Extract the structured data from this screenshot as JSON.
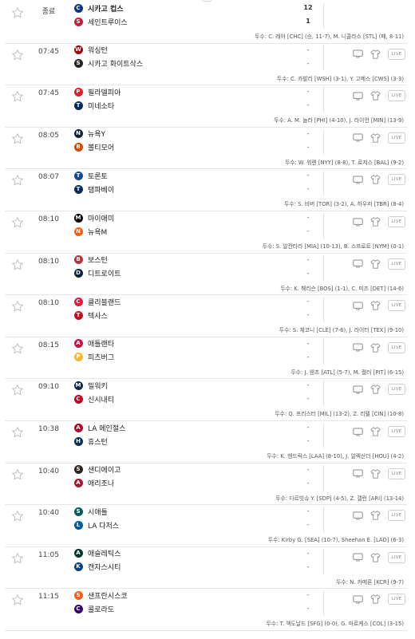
{
  "games": [
    {
      "status": "종료",
      "away": {
        "name": "시카고 컵스",
        "bold": true,
        "color": "#0e3386",
        "abbr": "C"
      },
      "home": {
        "name": "세인트루이스",
        "bold": false,
        "color": "#c41e3a",
        "abbr": "S"
      },
      "score_away": "12",
      "score_home": "1",
      "final": true,
      "pitchers": "두수: C. 레아 [CHC] (승, 11-7), M. 니콜라스 [STL] (패, 8-11)"
    },
    {
      "status": "07:45",
      "away": {
        "name": "워싱턴",
        "bold": false,
        "color": "#ab0003",
        "abbr": "W"
      },
      "home": {
        "name": "시카고 화이트삭스",
        "bold": false,
        "color": "#27251f",
        "abbr": "S"
      },
      "score_away": "-",
      "score_home": "-",
      "final": false,
      "pitchers": "두수: C. 카발리 [WSH] (3-1), Y. 고메스 [CWS] (3-3)"
    },
    {
      "status": "07:45",
      "away": {
        "name": "필라델피아",
        "bold": false,
        "color": "#e81828",
        "abbr": "P"
      },
      "home": {
        "name": "미네소타",
        "bold": false,
        "color": "#002b5c",
        "abbr": "T"
      },
      "score_away": "-",
      "score_home": "-",
      "final": false,
      "pitchers": "두수: A. M. 놀라 [PHI] (4-10), J. 라이언 [MIN] (13-9)"
    },
    {
      "status": "08:05",
      "away": {
        "name": "뉴욕Y",
        "bold": false,
        "color": "#0c2340",
        "abbr": "NY"
      },
      "home": {
        "name": "볼티모어",
        "bold": false,
        "color": "#df4601",
        "abbr": "B"
      },
      "score_away": "-",
      "score_home": "-",
      "final": false,
      "pitchers": "두수: W. 워렌 [NYY] (8-8), T. 로저스 [BAL] (9-2)"
    },
    {
      "status": "08:07",
      "away": {
        "name": "토론토",
        "bold": false,
        "color": "#134a8e",
        "abbr": "T"
      },
      "home": {
        "name": "탬파베이",
        "bold": false,
        "color": "#092c5c",
        "abbr": "TB"
      },
      "score_away": "-",
      "score_home": "-",
      "final": false,
      "pitchers": "두수: S. 비버 [TOR] (3-2), A. 하우저 [TBR] (8-4)"
    },
    {
      "status": "08:10",
      "away": {
        "name": "마이애미",
        "bold": false,
        "color": "#000000",
        "abbr": "M"
      },
      "home": {
        "name": "뉴욕M",
        "bold": false,
        "color": "#ff5910",
        "abbr": "NY"
      },
      "score_away": "-",
      "score_home": "-",
      "final": false,
      "pitchers": "두수: S. 알칸타라 [MIA] (10-13), B. 스프로트 [NYM] (0-1)"
    },
    {
      "status": "08:10",
      "away": {
        "name": "보스턴",
        "bold": false,
        "color": "#bd3039",
        "abbr": "B"
      },
      "home": {
        "name": "디트로이트",
        "bold": false,
        "color": "#0c2340",
        "abbr": "D"
      },
      "score_away": "-",
      "score_home": "-",
      "final": false,
      "pitchers": "두수: K. 해리슨 [BOS] (1-1), C. 미즈 [DET] (14-6)"
    },
    {
      "status": "08:10",
      "away": {
        "name": "클리블랜드",
        "bold": false,
        "color": "#e31937",
        "abbr": "C"
      },
      "home": {
        "name": "텍사스",
        "bold": false,
        "color": "#c0111f",
        "abbr": "T"
      },
      "score_away": "-",
      "score_home": "-",
      "final": false,
      "pitchers": "두수: S. 체코니 [CLE] (7-6), J. 라이터 [TEX] (9-10)"
    },
    {
      "status": "08:15",
      "away": {
        "name": "애틀랜타",
        "bold": false,
        "color": "#ce1141",
        "abbr": "A"
      },
      "home": {
        "name": "피츠버그",
        "bold": false,
        "color": "#fdb827",
        "abbr": "P"
      },
      "score_away": "-",
      "score_home": "-",
      "final": false,
      "pitchers": "두수: J. 웬츠 [ATL] (5-7), M. 켈러 [PIT] (6-15)"
    },
    {
      "status": "09:10",
      "away": {
        "name": "밀워키",
        "bold": false,
        "color": "#12284b",
        "abbr": "M"
      },
      "home": {
        "name": "신시내티",
        "bold": false,
        "color": "#c6011f",
        "abbr": "C"
      },
      "score_away": "-",
      "score_home": "-",
      "final": false,
      "pitchers": "두수: Q. 프리스터 [MIL] (13-2), Z. 리텔 [CIN] (10-8)"
    },
    {
      "status": "10:38",
      "away": {
        "name": "LA 에인절스",
        "bold": false,
        "color": "#ba0021",
        "abbr": "A"
      },
      "home": {
        "name": "휴스턴",
        "bold": false,
        "color": "#002d62",
        "abbr": "H"
      },
      "score_away": "-",
      "score_home": "-",
      "final": false,
      "pitchers": "두수: K. 헨드릭스 [LAA] (8-10), J. 알렉산더 [HOU] (4-2)"
    },
    {
      "status": "10:40",
      "away": {
        "name": "샌디에이고",
        "bold": false,
        "color": "#2f241d",
        "abbr": "SD"
      },
      "home": {
        "name": "애리조나",
        "bold": false,
        "color": "#a71930",
        "abbr": "A"
      },
      "score_away": "-",
      "score_home": "-",
      "final": false,
      "pitchers": "두수: 다르빗슈 Y. [SDP] (4-5), Z. 갤런 [ARI] (13-14)"
    },
    {
      "status": "10:40",
      "away": {
        "name": "시애틀",
        "bold": false,
        "color": "#005c5c",
        "abbr": "S"
      },
      "home": {
        "name": "LA 다저스",
        "bold": false,
        "color": "#005a9c",
        "abbr": "LA"
      },
      "score_away": "-",
      "score_home": "-",
      "final": false,
      "pitchers": "두수: Kirby G. [SEA] (10-7), Sheehan E. [LAD] (6-3)"
    },
    {
      "status": "11:05",
      "away": {
        "name": "애슬레틱스",
        "bold": false,
        "color": "#003831",
        "abbr": "A"
      },
      "home": {
        "name": "캔자스시티",
        "bold": false,
        "color": "#004687",
        "abbr": "KC"
      },
      "score_away": "-",
      "score_home": "-",
      "final": false,
      "pitchers": "두수: N. 카메론 [KCR] (9-7)"
    },
    {
      "status": "11:15",
      "away": {
        "name": "샌프란시스코",
        "bold": false,
        "color": "#fd5a1e",
        "abbr": "SF"
      },
      "home": {
        "name": "콜로라도",
        "bold": false,
        "color": "#33006f",
        "abbr": "C"
      },
      "score_away": "-",
      "score_home": "-",
      "final": false,
      "pitchers": "두수: T. 맥도날드 [SFG] (0-0), G. 마르케스 [COL] (3-15)"
    }
  ],
  "icons": {
    "star": "star-icon",
    "tv": "tv-icon",
    "shirt": "jersey-icon"
  },
  "live_label": "LIVE"
}
